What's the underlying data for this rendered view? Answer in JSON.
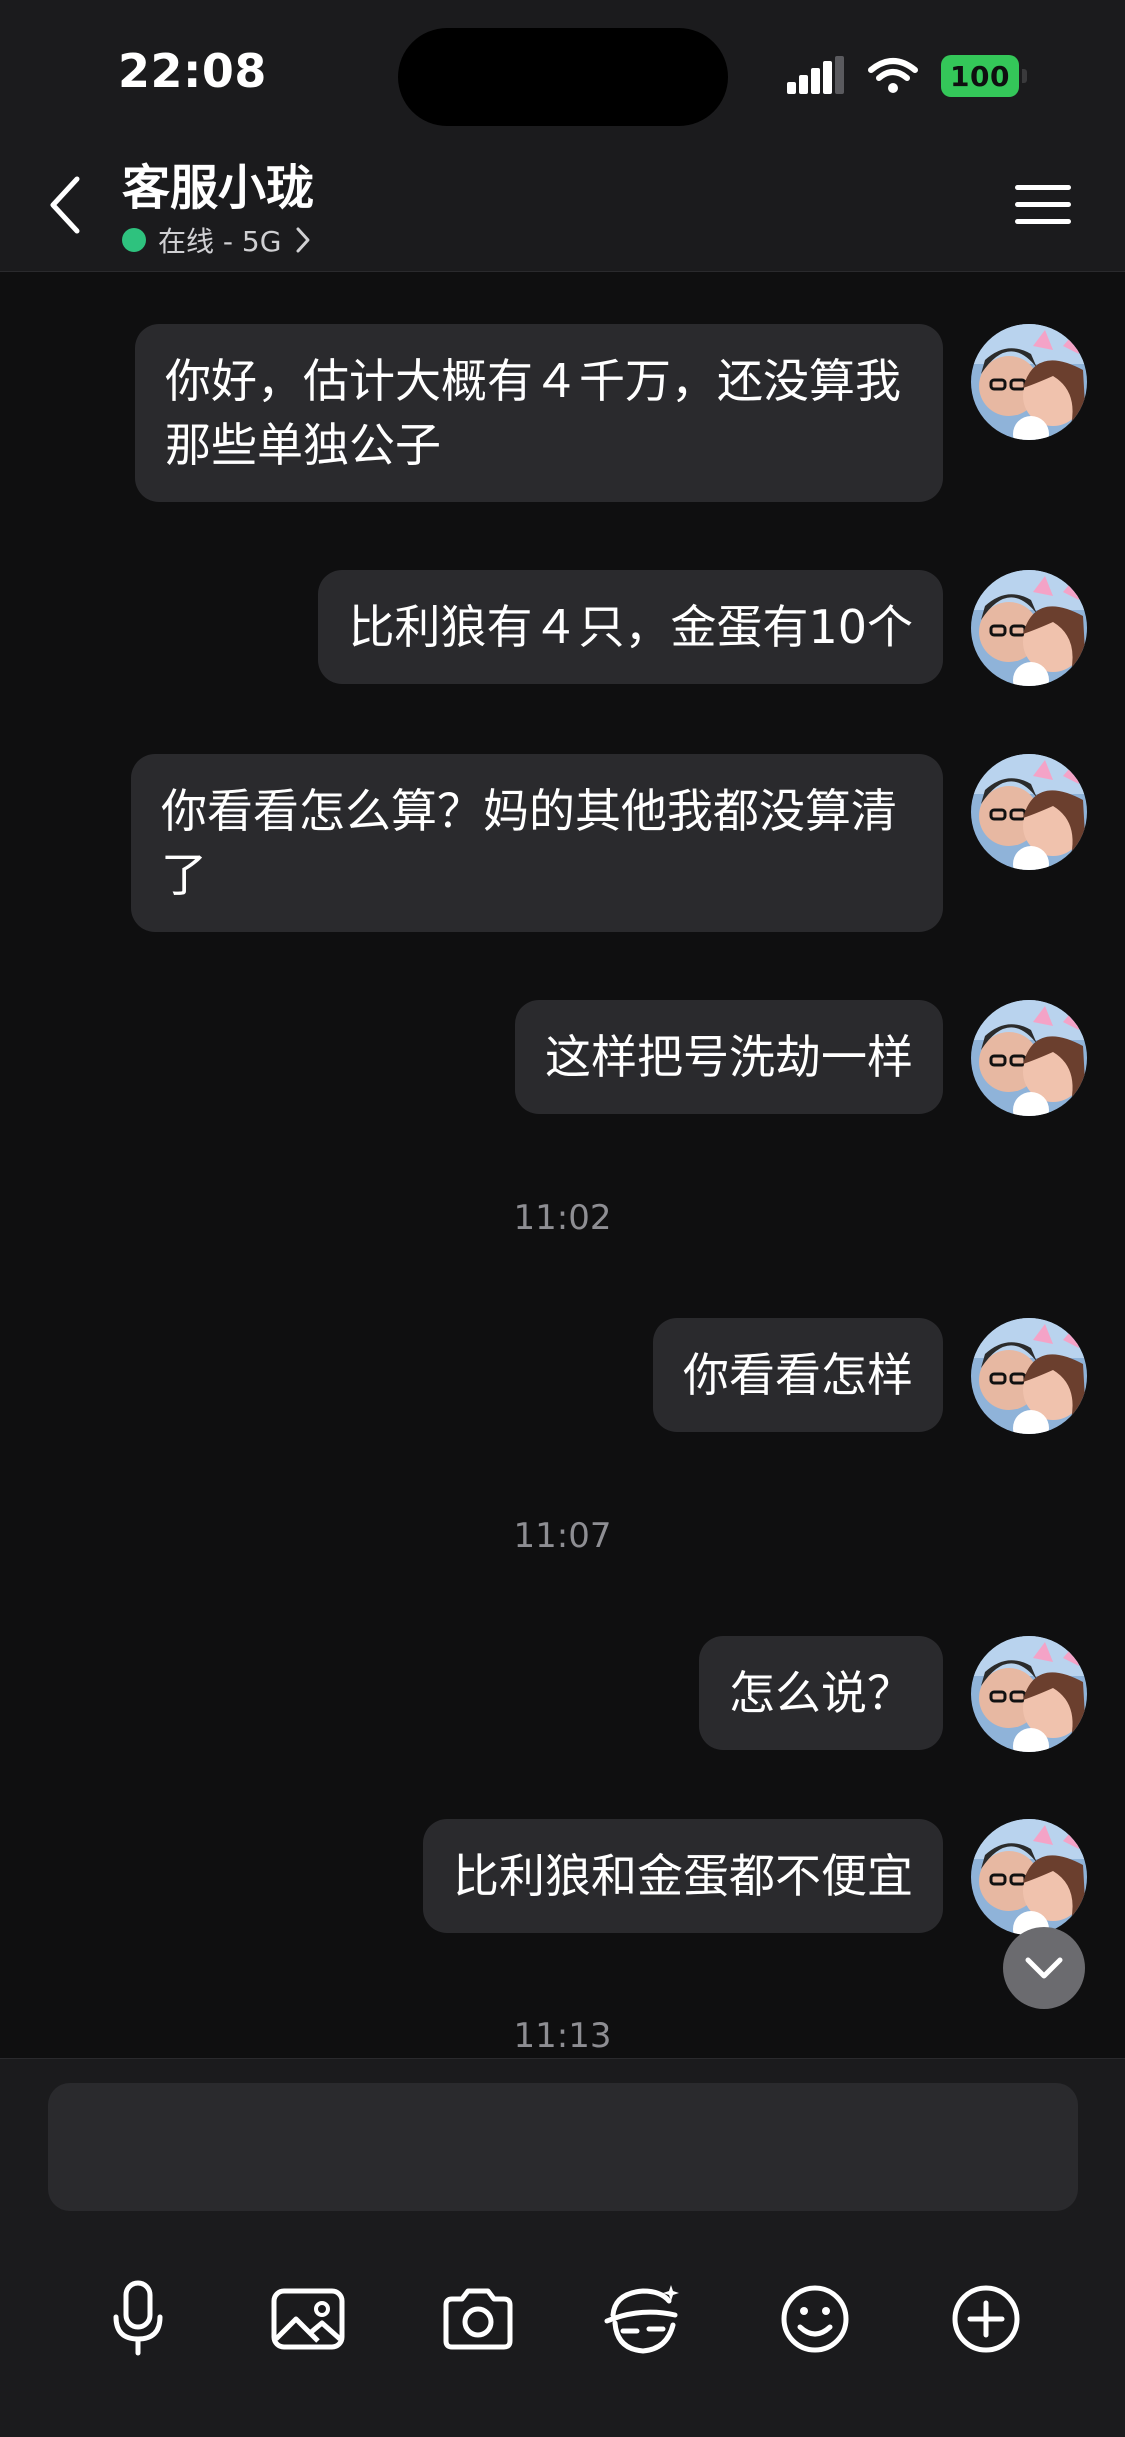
{
  "status_bar": {
    "time": "22:08",
    "battery": "100"
  },
  "header": {
    "title": "客服小珑",
    "subtitle": "在线 - 5G"
  },
  "messages": [
    {
      "text": "你好，估计大概有４千万，还没算我那些单独公子"
    },
    {
      "text": "比利狼有４只，金蛋有10个"
    },
    {
      "text": "你看看怎么算？妈的其他我都没算清了"
    },
    {
      "text": "这样把号洗劫一样"
    },
    {
      "text": "你看看怎样"
    },
    {
      "text": "怎么说？"
    },
    {
      "text": "比利狼和金蛋都不便宜"
    }
  ],
  "timestamps": [
    "11:02",
    "11:07",
    "11:13"
  ],
  "input": {
    "placeholder": ""
  },
  "icons": {
    "back": "chevron-left-icon",
    "menu": "hamburger-menu-icon",
    "toolbar": [
      "microphone-icon",
      "image-icon",
      "camera-icon",
      "sticker-face-icon",
      "emoji-icon",
      "plus-circle-icon"
    ]
  },
  "colors": {
    "online": "#2ec27e",
    "battery": "#34c759",
    "bubble": "#2a2a2d",
    "background": "#0f0f10"
  }
}
